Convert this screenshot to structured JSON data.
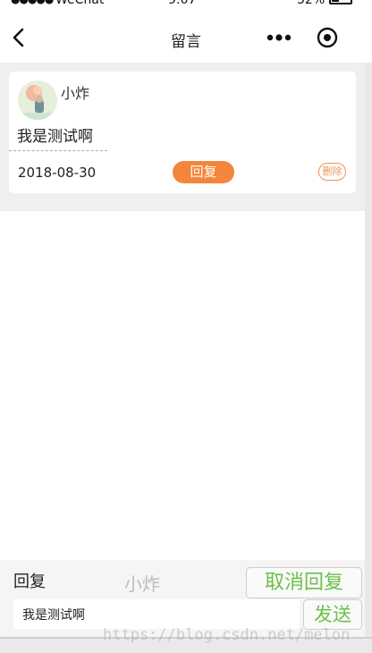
{
  "status_bar": {
    "signal": "●●●●●",
    "carrier": "WeChat",
    "time": "9:07",
    "battery_percent": "32%"
  },
  "nav": {
    "title": "留言"
  },
  "comments": [
    {
      "username": "小炸",
      "message": "我是测试啊",
      "date": "2018-08-30",
      "reply_label": "回复",
      "delete_label": "删除"
    }
  ],
  "reply_bar": {
    "label": "回复",
    "target_name": "小炸",
    "cancel_label": "取消回复",
    "input_value": "我是测试啊",
    "send_label": "发送"
  },
  "watermark": "https://blog.csdn.net/melon",
  "colors": {
    "accent_orange": "#f5853a",
    "accent_green": "#6cc04a",
    "content_bg": "#efefef"
  }
}
